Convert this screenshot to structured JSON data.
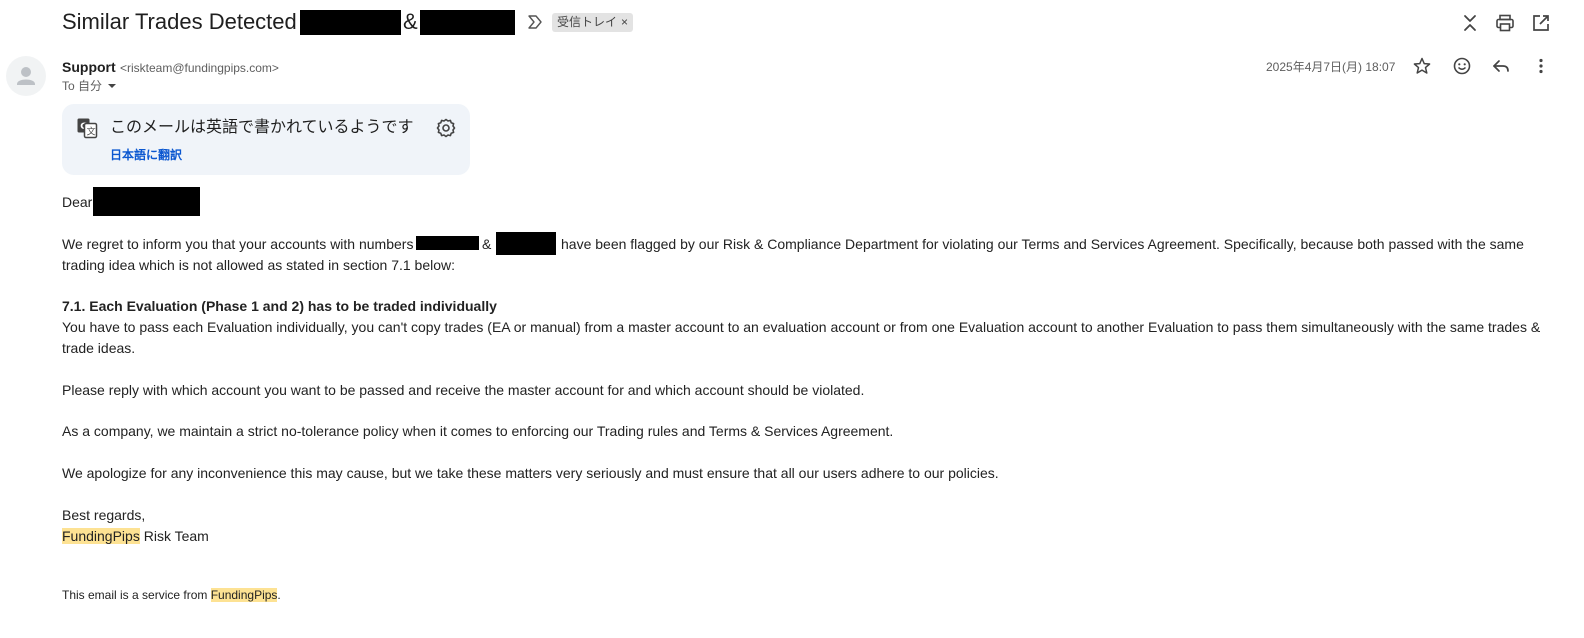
{
  "header": {
    "subject": "Similar Trades Detected",
    "subject_amp": "&",
    "label_chip": "受信トレイ",
    "label_close": "×"
  },
  "message": {
    "sender_name": "Support",
    "sender_email": "<riskteam@fundingpips.com>",
    "to_label": "To 自分",
    "date": "2025年4月7日(月) 18:07"
  },
  "translate": {
    "title": "このメールは英語で書かれているようです",
    "link": "日本語に翻訳"
  },
  "body": {
    "greeting": "Dear",
    "p1_a": "We regret to inform you that your accounts with numbers",
    "p1_amp": "&",
    "p1_b": "have been flagged by our Risk & Compliance Department for violating our Terms and Services Agreement. Specifically, because both passed with the same",
    "p1_c": "trading idea which is not allowed as stated in section 7.1 below:",
    "rule_heading": "7.1. Each Evaluation (Phase 1 and 2) has to be traded individually",
    "rule_a": "You have to pass each Evaluation individually, you can't copy trades (EA or manual) from a master account to an evaluation account or from one Evaluation account to another Evaluation to pass them simultaneously with the same trades &",
    "rule_b": "trade ideas.",
    "p2": "Please reply with which account you want to be passed and receive the master account for and which account should be violated.",
    "p3": "As a company, we maintain a strict no-tolerance policy when it comes to enforcing our Trading rules and Terms & Services Agreement.",
    "p4": "We apologize for any inconvenience this may cause, but we take these matters very seriously and must ensure that all our users adhere to our policies.",
    "closing": "Best regards,",
    "sign_brand": "FundingPips",
    "sign_rest": " Risk Team",
    "footer_a": "This email is a service from ",
    "footer_brand": "FundingPips",
    "footer_b": "."
  },
  "icons": {
    "label_arrow": "label-arrow-icon",
    "expand": "expand-collapse-icon",
    "print": "print-icon",
    "open": "open-in-new-window-icon",
    "star": "star-icon",
    "emoji": "emoji-reaction-icon",
    "reply": "reply-icon",
    "more": "more-vert-icon",
    "translate": "translate-icon",
    "settings": "gear-icon",
    "avatar": "avatar-person-icon"
  },
  "colors": {
    "highlight": "#fde293",
    "link": "#0b57d0",
    "card_bg": "#f0f4f9"
  }
}
